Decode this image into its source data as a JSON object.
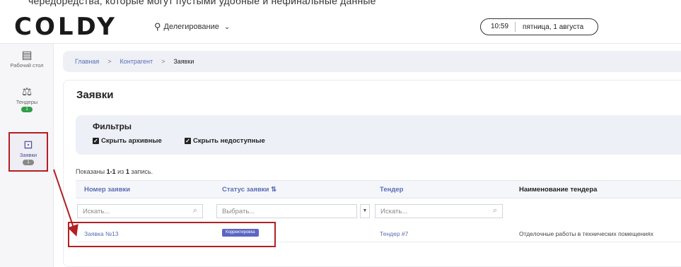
{
  "top_text": "чередоредства, которые могут пустыми удобные и нефинальные данные",
  "header": {
    "logo": "COLDY",
    "delegation_label": "Делегирование",
    "time": "10:59",
    "date": "пятница, 1 августа"
  },
  "sidebar": {
    "items": [
      {
        "label": "Рабочий стол",
        "icon": "monitor-icon"
      },
      {
        "label": "Тендеры",
        "icon": "gavel-icon",
        "badge": "1"
      },
      {
        "label": "Заявки",
        "icon": "add-request-icon",
        "badge": "1"
      }
    ]
  },
  "breadcrumb": {
    "items": [
      "Главная",
      "Контрагент",
      "Заявки"
    ],
    "separator": ">"
  },
  "page": {
    "title": "Заявки",
    "filters": {
      "title": "Фильтры",
      "hide_archived": "Скрыть архивные",
      "hide_unavailable": "Скрыть недоступные"
    },
    "summary": {
      "prefix": "Показаны",
      "range": "1-1",
      "middle": "из",
      "total": "1",
      "suffix": "запись."
    }
  },
  "table": {
    "columns": [
      "Номер заявки",
      "Статус заявки",
      "Тендер",
      "Наименование тендера"
    ],
    "sort_icon": "⇅",
    "filters": {
      "number_placeholder": "Искать...",
      "status_placeholder": "Выбрать...",
      "tender_placeholder": "Искать..."
    },
    "rows": [
      {
        "number": "Заявка №13",
        "status": "Корректировка",
        "tender": "Тендер #7",
        "tender_name": "Отделочные работы в технических помещениях"
      }
    ]
  },
  "colors": {
    "accent_link": "#5a6db5",
    "highlight": "#b21f24",
    "status_badge": "#5b66c4",
    "badge_green": "#2e9e46"
  }
}
